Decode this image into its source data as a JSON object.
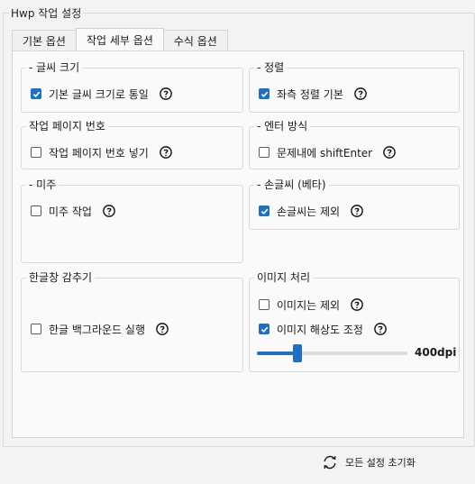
{
  "window": {
    "title": "Hwp 작업 설정"
  },
  "tabs": [
    {
      "label": "기본 옵션",
      "active": false
    },
    {
      "label": "작업 세부 옵션",
      "active": true
    },
    {
      "label": "수식 옵션",
      "active": false
    }
  ],
  "groups": {
    "font_size": {
      "title": "- 글씨 크기",
      "options": [
        {
          "label": "기본 글씨 크기로 통일",
          "checked": true
        }
      ]
    },
    "align": {
      "title": "- 정렬",
      "options": [
        {
          "label": "좌측 정렬 기본",
          "checked": true
        }
      ]
    },
    "page_number": {
      "title": "작업 페이지 번호",
      "options": [
        {
          "label": "작업 페이지 번호 넣기",
          "checked": false
        }
      ]
    },
    "enter": {
      "title": "- 엔터 방식",
      "options": [
        {
          "label": "문제내에 shiftEnter",
          "checked": false
        }
      ]
    },
    "mizu": {
      "title": "- 미주",
      "options": [
        {
          "label": "미주 작업",
          "checked": false
        }
      ]
    },
    "handwriting": {
      "title": "- 손글씨 (베타)",
      "options": [
        {
          "label": "손글씨는 제외",
          "checked": true
        }
      ]
    },
    "hide_window": {
      "title": "한글창 감추기",
      "options": [
        {
          "label": "한글 백그라운드 실행",
          "checked": false
        }
      ]
    },
    "image": {
      "title": "이미지 처리",
      "options": [
        {
          "label": "이미지는 제외",
          "checked": false
        },
        {
          "label": "이미지 해상도 조정",
          "checked": true
        }
      ],
      "dpi_label": "400dpi",
      "dpi_fraction": 0.27
    }
  },
  "footer": {
    "reset_label": "모든 설정 초기화"
  },
  "colors": {
    "accent": "#1f6fc9",
    "background": "#f3f3f3",
    "panel": "#fafafa"
  }
}
